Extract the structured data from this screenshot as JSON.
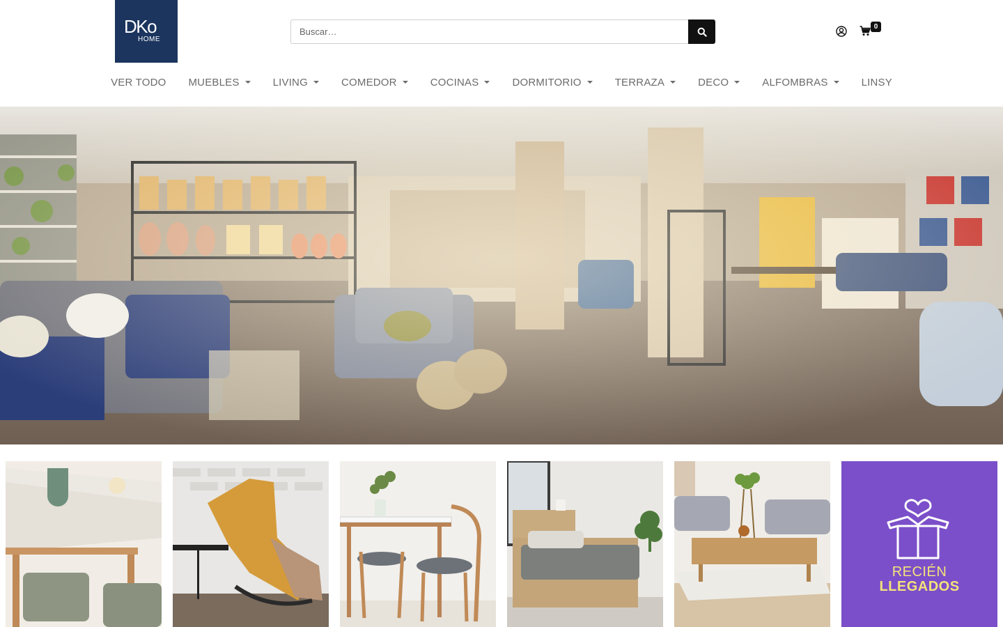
{
  "brand": {
    "logo_text_main": "DKo",
    "logo_text_sub": "HOME",
    "logo_bg": "#1b355e"
  },
  "search": {
    "placeholder": "Buscar…",
    "button_icon": "search-icon"
  },
  "account": {
    "user_icon": "user-circle-icon",
    "cart_icon": "shopping-cart-icon",
    "cart_count": "0"
  },
  "nav": {
    "items": [
      {
        "label": "VER TODO",
        "dropdown": false
      },
      {
        "label": "MUEBLES",
        "dropdown": true
      },
      {
        "label": "LIVING",
        "dropdown": true
      },
      {
        "label": "COMEDOR",
        "dropdown": true
      },
      {
        "label": "COCINAS",
        "dropdown": true
      },
      {
        "label": "DORMITORIO",
        "dropdown": true
      },
      {
        "label": "TERRAZA",
        "dropdown": true
      },
      {
        "label": "DECO",
        "dropdown": true
      },
      {
        "label": "ALFOMBRAS",
        "dropdown": true
      },
      {
        "label": "LINSY",
        "dropdown": false
      }
    ]
  },
  "hero": {
    "image": "store-interior-photo"
  },
  "tiles": {
    "items": [
      {
        "image": "dining-table-chairs-photo"
      },
      {
        "image": "yellow-lounge-chair-photo"
      },
      {
        "image": "dining-set-photo"
      },
      {
        "image": "bed-photo"
      },
      {
        "image": "living-room-coffee-table-photo"
      },
      {
        "line1": "RECIÉN",
        "line2": "LLEGADOS",
        "bg": "#7b4fc9",
        "accent": "#f3e27a",
        "icon": "gift-box-heart-icon"
      }
    ]
  }
}
